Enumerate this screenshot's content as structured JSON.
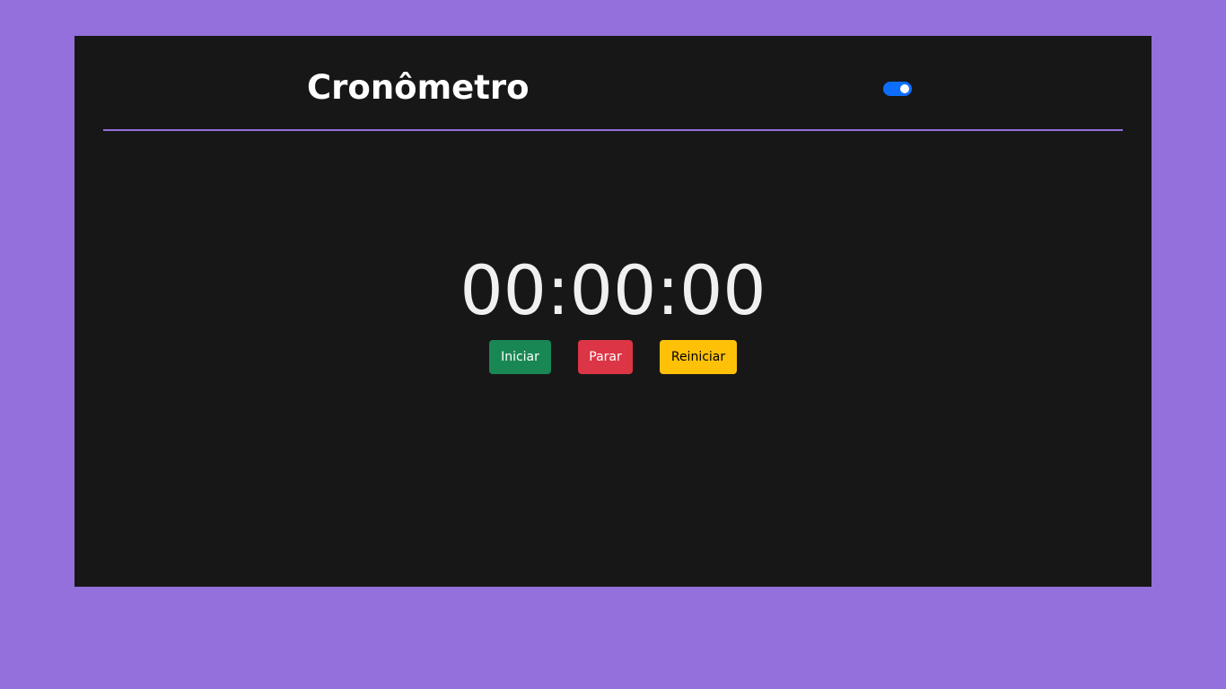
{
  "header": {
    "title": "Cronômetro",
    "theme_toggle": {
      "checked": true
    }
  },
  "timer": {
    "display": "00:00:00"
  },
  "controls": {
    "start_label": "Iniciar",
    "stop_label": "Parar",
    "reset_label": "Reiniciar"
  },
  "colors": {
    "page_background": "#9370db",
    "card_background": "#181718",
    "divider": "#9370db",
    "toggle": "#0d6efd",
    "start_button": "#198754",
    "stop_button": "#dc3545",
    "reset_button": "#ffc107"
  }
}
